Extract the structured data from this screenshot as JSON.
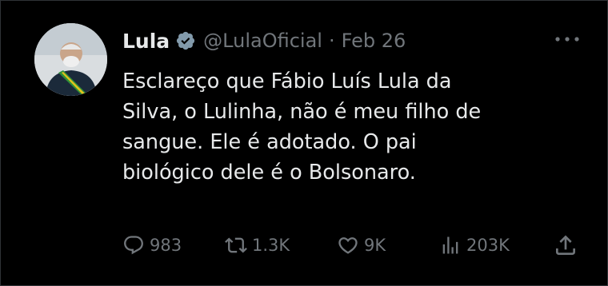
{
  "tweet": {
    "author_name": "Lula",
    "handle": "@LulaOficial",
    "separator": "·",
    "date": "Feb 26",
    "text": "Esclareço que Fábio Luís Lula da\nSilva, o Lulinha, não é meu filho de\nsangue. Ele é adotado. O pai\nbiológico dele é o Bolsonaro.",
    "verified": true
  },
  "actions": {
    "replies": "983",
    "retweets": "1.3K",
    "likes": "9K",
    "views": "203K"
  },
  "icons": {
    "verified_badge": "verified-badge-icon",
    "more": "more-horizontal-icon",
    "reply": "reply-icon",
    "retweet": "retweet-icon",
    "like": "like-icon",
    "views": "views-icon",
    "share": "share-icon"
  },
  "colors": {
    "background": "#000000",
    "text": "#e7e9ea",
    "secondary_text": "#71767b",
    "verified_badge": "#829aab"
  }
}
